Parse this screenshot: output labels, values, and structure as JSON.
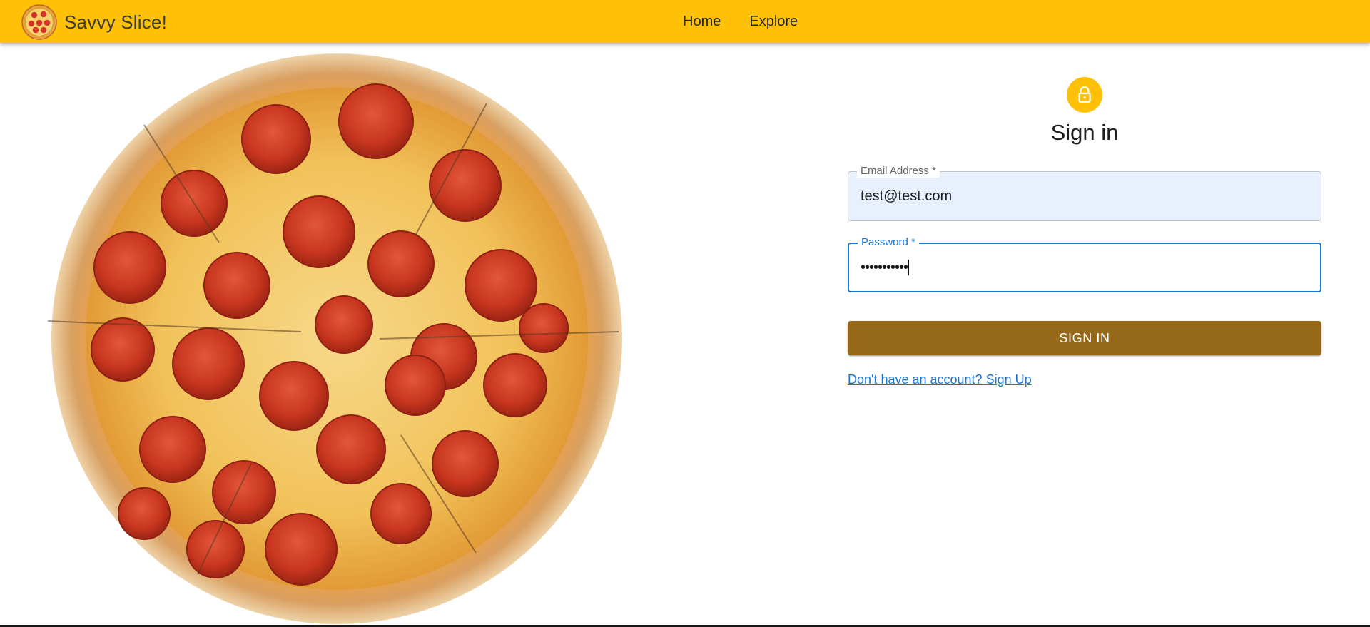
{
  "appbar": {
    "brand_title": "Savvy Slice!",
    "brand_logo_icon": "pizza-icon",
    "nav": [
      {
        "label": "Home"
      },
      {
        "label": "Explore"
      }
    ],
    "background_color": "#ffc107"
  },
  "hero": {
    "image": "pepperoni-pizza"
  },
  "signin": {
    "avatar_icon": "lock-icon",
    "heading": "Sign in",
    "email": {
      "label": "Email Address *",
      "value": "test@test.com"
    },
    "password": {
      "label": "Password *",
      "masked_value": "•••••••••••"
    },
    "submit_label": "SIGN IN",
    "signup_link": "Don't have an account? Sign Up"
  },
  "colors": {
    "accent_yellow": "#ffc107",
    "button_brown": "#96691a",
    "focus_blue": "#1976d2",
    "autofill_blue": "#e8f0fe"
  }
}
